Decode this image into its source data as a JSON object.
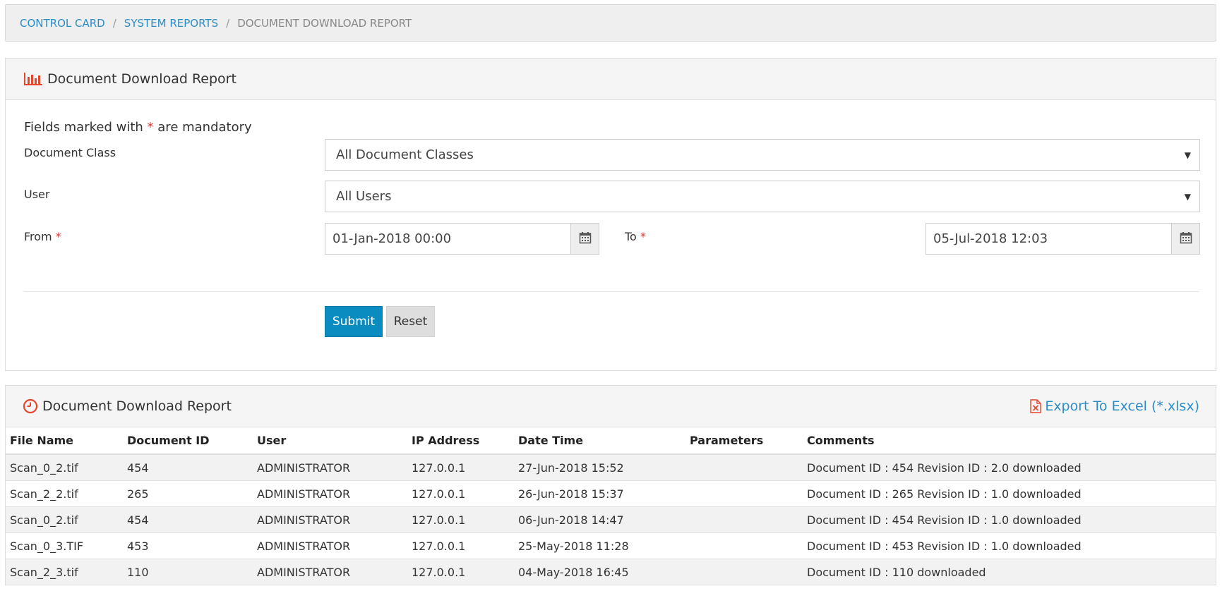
{
  "breadcrumb": {
    "items": [
      "CONTROL CARD",
      "SYSTEM REPORTS"
    ],
    "separator": "/",
    "current": "DOCUMENT DOWNLOAD REPORT"
  },
  "form_panel": {
    "title": "Document Download Report",
    "icon": "bar-chart-icon",
    "mandatory_note_before": "Fields marked with",
    "mandatory_star": "*",
    "mandatory_note_after": "are mandatory",
    "document_class": {
      "label": "Document Class",
      "value": "All Document Classes",
      "caret": "▼"
    },
    "user": {
      "label": "User",
      "value": "All Users",
      "caret": "▼"
    },
    "from": {
      "label": "From",
      "value": "01-Jan-2018 00:00"
    },
    "to": {
      "label": "To",
      "value": "05-Jul-2018 12:03"
    },
    "submit_label": "Submit",
    "reset_label": "Reset"
  },
  "report_panel": {
    "title": "Document Download Report",
    "icon": "clock-icon",
    "export_label": "Export To Excel (*.xlsx)",
    "columns": [
      "File Name",
      "Document ID",
      "User",
      "IP Address",
      "Date Time",
      "Parameters",
      "Comments"
    ],
    "rows": [
      [
        "Scan_0_2.tif",
        "454",
        "ADMINISTRATOR",
        "127.0.0.1",
        "27-Jun-2018 15:52",
        "",
        "Document ID : 454 Revision ID : 2.0 downloaded"
      ],
      [
        "Scan_2_2.tif",
        "265",
        "ADMINISTRATOR",
        "127.0.0.1",
        "26-Jun-2018 15:37",
        "",
        "Document ID : 265 Revision ID : 1.0 downloaded"
      ],
      [
        "Scan_0_2.tif",
        "454",
        "ADMINISTRATOR",
        "127.0.0.1",
        "06-Jun-2018 14:47",
        "",
        "Document ID : 454 Revision ID : 1.0 downloaded"
      ],
      [
        "Scan_0_3.TIF",
        "453",
        "ADMINISTRATOR",
        "127.0.0.1",
        "25-May-2018 11:28",
        "",
        "Document ID : 453 Revision ID : 1.0 downloaded"
      ],
      [
        "Scan_2_3.tif",
        "110",
        "ADMINISTRATOR",
        "127.0.0.1",
        "04-May-2018 16:45",
        "",
        "Document ID : 110 downloaded"
      ]
    ]
  },
  "colors": {
    "link": "#2a8dc8",
    "primary_button": "#0a8cc0",
    "required_star": "#e03434",
    "icon_red": "#e8452c"
  }
}
